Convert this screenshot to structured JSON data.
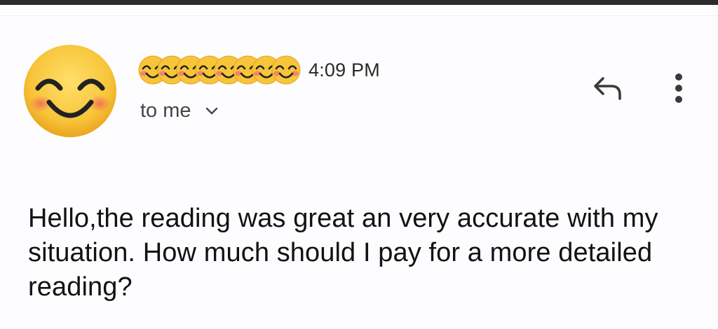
{
  "message": {
    "time": "4:09 PM",
    "recipient_label": "to me",
    "body": "Hello,the reading was great an very accurate with my situation. How much should I pay for a more detailed reading?"
  },
  "icons": {
    "avatar": "smiling-face-with-smiling-eyes-icon",
    "sender_name_emoji": "smiling-face-with-smiling-eyes-icon",
    "recipient_toggle": "chevron-down-icon",
    "reply": "reply-arrow-icon",
    "more": "more-vertical-icon"
  },
  "colors": {
    "emoji_face": "#f7c53a",
    "emoji_blush": "#f26b5b",
    "background": "#fdfcfe",
    "text": "#121212",
    "secondary_text": "#444746"
  }
}
